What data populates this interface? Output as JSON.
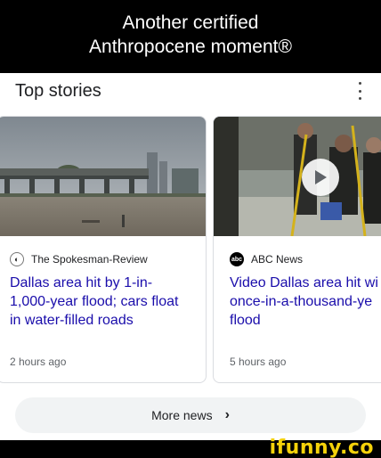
{
  "caption": {
    "line1": "Another certified",
    "line2": "Anthropocene moment®"
  },
  "header": {
    "title": "Top stories",
    "menu_icon": "more-vert-icon"
  },
  "stories": [
    {
      "source": "The Spokesman-Review",
      "source_icon": "spokesman-review-logo",
      "headline_lines": [
        "Dallas area hit by 1-in-",
        "1,000-year flood; cars float",
        "in water-filled roads"
      ],
      "time": "2 hours ago",
      "has_video": false
    },
    {
      "source": "ABC News",
      "source_icon": "abc-news-logo",
      "source_icon_text": "abc",
      "headline_lines": [
        "Video Dallas area hit wi",
        "once-in-a-thousand-ye",
        "flood"
      ],
      "time": "5 hours ago",
      "has_video": true
    }
  ],
  "more_button": {
    "label": "More news",
    "icon": "chevron-right-icon"
  },
  "watermark": {
    "text": "ifunny.co"
  },
  "colors": {
    "headline": "#1a0dab",
    "meta": "#5f6368",
    "pill": "#f1f3f4",
    "watermark": "#f5d20a"
  }
}
